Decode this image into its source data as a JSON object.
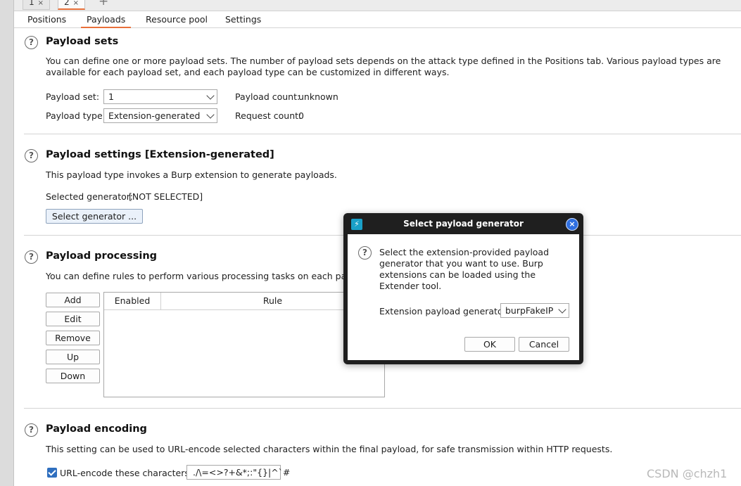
{
  "request_tabs": [
    {
      "label": "1",
      "close": "×"
    },
    {
      "label": "2",
      "close": "×"
    }
  ],
  "request_tabs_add": "+",
  "sub_tabs": [
    "Positions",
    "Payloads",
    "Resource pool",
    "Settings"
  ],
  "help_glyph": "?",
  "payload_sets": {
    "heading": "Payload sets",
    "description": "You can define one or more payload sets. The number of payload sets depends on the attack type defined in the Positions tab. Various payload types are available for each payload set, and each payload type can be customized in different ways.",
    "set_label": "Payload set:",
    "set_value": "1",
    "type_label": "Payload type:",
    "type_value": "Extension-generated",
    "count_label": "Payload count:",
    "count_value": "unknown",
    "request_label": "Request count:",
    "request_value": "0"
  },
  "payload_settings": {
    "heading": "Payload settings [Extension-generated]",
    "description": "This payload type invokes a Burp extension to generate payloads.",
    "generator_label": "Selected generator:",
    "generator_value": "[NOT SELECTED]",
    "select_button": "Select generator ..."
  },
  "payload_processing": {
    "heading": "Payload processing",
    "description": "You can define rules to perform various processing tasks on each payload before it is used.",
    "buttons": [
      "Add",
      "Edit",
      "Remove",
      "Up",
      "Down"
    ],
    "columns": [
      "Enabled",
      "Rule"
    ]
  },
  "payload_encoding": {
    "heading": "Payload encoding",
    "description": "This setting can be used to URL-encode selected characters within the final payload, for safe transmission within HTTP requests.",
    "checkbox_label": "URL-encode these characters:",
    "checkbox_checked": true,
    "characters": "./\\=<>?+&*;:\"{}|^`#"
  },
  "dialog": {
    "title": "Select payload generator",
    "app_icon": "⚡",
    "close": "×",
    "message": "Select the extension-provided payload generator that you want to use. Burp extensions can be loaded using the Extender tool.",
    "generator_label": "Extension payload generator:",
    "generator_value": "burpFakeIP",
    "ok": "OK",
    "cancel": "Cancel"
  },
  "watermark": "CSDN @chzh1"
}
